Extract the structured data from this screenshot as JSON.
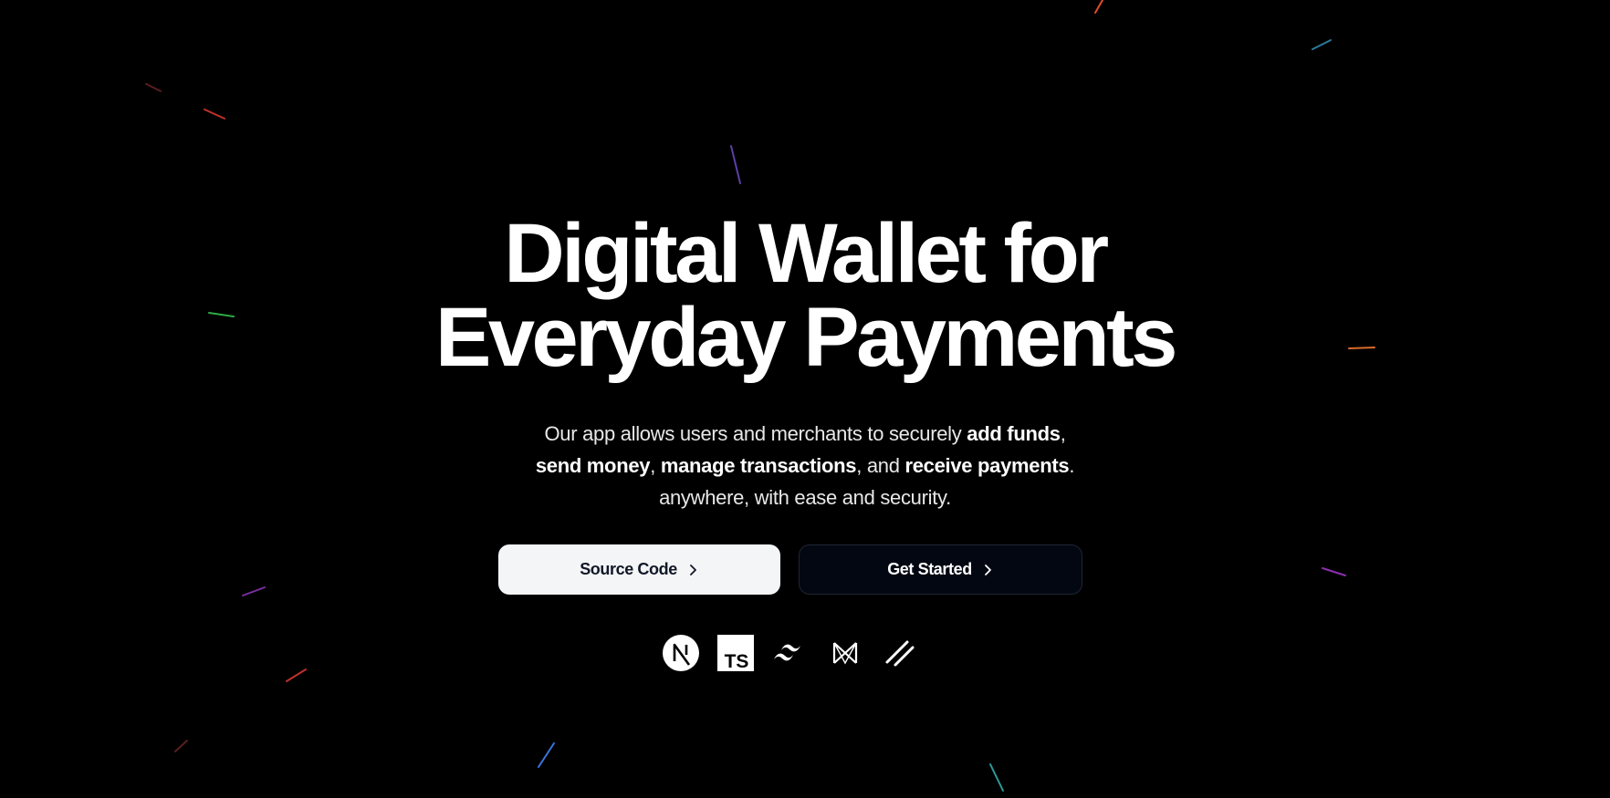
{
  "hero": {
    "headline_line1": "Digital Wallet for",
    "headline_line2": "Everyday Payments",
    "description": {
      "t1": "Our app allows users and merchants to securely ",
      "b1": "add funds",
      "t2": ", ",
      "b2": "send money",
      "t3": ", ",
      "b3": "manage transactions",
      "t4": ", and ",
      "b4": "receive payments",
      "t5": ".",
      "t6": "anywhere, with ease and security."
    }
  },
  "actions": {
    "source_code_label": "Source Code",
    "get_started_label": "Get Started"
  },
  "tech_stack": [
    {
      "icon": "nextjs-icon"
    },
    {
      "icon": "typescript-icon",
      "text": "TS"
    },
    {
      "icon": "tailwindcss-icon"
    },
    {
      "icon": "prisma-icon"
    },
    {
      "icon": "shadcn-icon"
    }
  ],
  "colors": {
    "background": "#000000",
    "text": "#ffffff",
    "button_light_bg": "#f4f5f7",
    "button_dark_bg": "#030712",
    "button_dark_border": "#1f2533"
  }
}
